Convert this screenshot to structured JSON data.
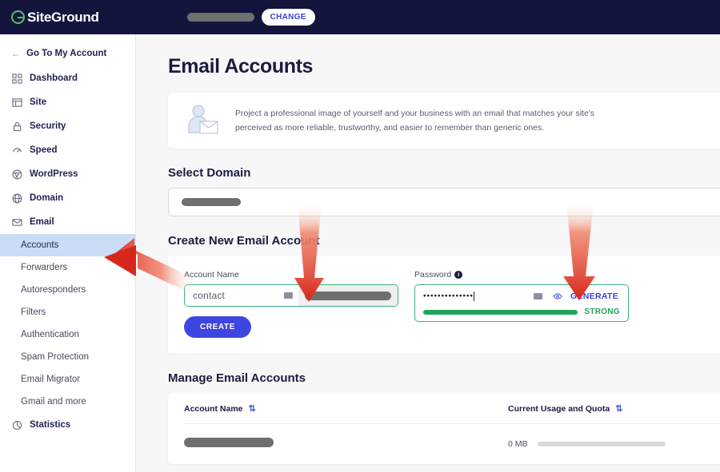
{
  "topbar": {
    "logo_text": "SiteGround",
    "domain_redacted": true,
    "change_label": "CHANGE"
  },
  "sidebar": {
    "back_label": "Go To My Account",
    "items": [
      {
        "label": "Dashboard",
        "icon": "grid-icon"
      },
      {
        "label": "Site",
        "icon": "layout-icon"
      },
      {
        "label": "Security",
        "icon": "lock-icon"
      },
      {
        "label": "Speed",
        "icon": "speed-icon"
      },
      {
        "label": "WordPress",
        "icon": "wordpress-icon"
      },
      {
        "label": "Domain",
        "icon": "globe-icon"
      },
      {
        "label": "Email",
        "icon": "envelope-icon"
      }
    ],
    "subitems": [
      {
        "label": "Accounts",
        "active": true
      },
      {
        "label": "Forwarders",
        "active": false
      },
      {
        "label": "Autoresponders",
        "active": false
      },
      {
        "label": "Filters",
        "active": false
      },
      {
        "label": "Authentication",
        "active": false
      },
      {
        "label": "Spam Protection",
        "active": false
      },
      {
        "label": "Email Migrator",
        "active": false
      },
      {
        "label": "Gmail and more",
        "active": false
      }
    ],
    "statistics": {
      "label": "Statistics",
      "icon": "pie-chart-icon"
    }
  },
  "main": {
    "page_title": "Email Accounts",
    "info_banner": {
      "line1": "Project a professional image of yourself and your business with an email that matches your site's",
      "line2": "perceived as more reliable, trustworthy, and easier to remember than generic ones."
    },
    "select_domain": {
      "title": "Select Domain",
      "value_redacted": true
    },
    "create_account": {
      "title": "Create New Email Account",
      "account_label": "Account Name",
      "account_value": "contact",
      "account_domain_redacted": true,
      "password_label": "Password",
      "password_value": "••••••••••••••",
      "generate_label": "GENERATE",
      "strength_label": "STRONG",
      "strength_color": "#22a45d",
      "create_label": "CREATE"
    },
    "manage": {
      "title": "Manage Email Accounts",
      "columns": [
        "Account Name",
        "Current Usage and Quota"
      ],
      "rows": [
        {
          "name_redacted": true,
          "usage": "0 MB",
          "usage_percent": 0
        }
      ]
    }
  },
  "annotations": {
    "arrow_color": "#e03423",
    "arrows": [
      {
        "name": "arrow-to-accounts",
        "direction": "left"
      },
      {
        "name": "arrow-to-account-name",
        "direction": "down"
      },
      {
        "name": "arrow-to-password",
        "direction": "down"
      }
    ]
  }
}
